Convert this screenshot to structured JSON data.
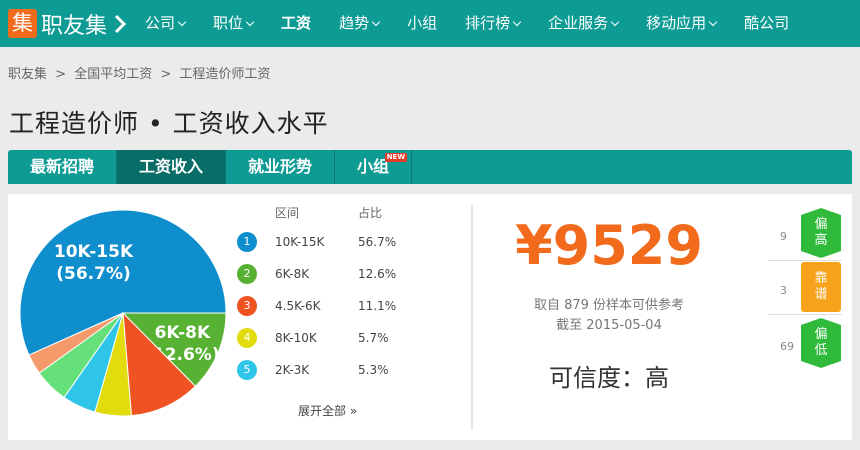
{
  "nav": {
    "logo_char": "集",
    "logo_text": "职友集",
    "items": [
      {
        "label": "公司",
        "dropdown": true
      },
      {
        "label": "职位",
        "dropdown": true
      },
      {
        "label": "工资",
        "dropdown": false,
        "active": true
      },
      {
        "label": "趋势",
        "dropdown": true
      },
      {
        "label": "小组",
        "dropdown": false
      },
      {
        "label": "排行榜",
        "dropdown": true
      },
      {
        "label": "企业服务",
        "dropdown": true
      },
      {
        "label": "移动应用",
        "dropdown": true
      },
      {
        "label": "酷公司",
        "dropdown": false
      }
    ]
  },
  "breadcrumb": [
    "职友集",
    ">",
    "全国平均工资",
    ">",
    "工程造价师工资"
  ],
  "page_title": "工程造价师 • 工资收入水平",
  "tabs": [
    {
      "label": "最新招聘"
    },
    {
      "label": "工资收入",
      "active": true
    },
    {
      "label": "就业形势"
    },
    {
      "label": "小组",
      "badge": "NEW"
    }
  ],
  "legend": {
    "col_range": "区间",
    "col_pct": "占比",
    "expand": "展开全部 »"
  },
  "chart_data": {
    "type": "pie",
    "slices": [
      {
        "rank": "1",
        "label": "10K-15K",
        "value": 56.7,
        "pct_text": "56.7%",
        "color": "#0f8ecd",
        "pie_label": "10K-15K",
        "pie_pct": "(56.7%)"
      },
      {
        "rank": "2",
        "label": "6K-8K",
        "value": 12.6,
        "pct_text": "12.6%",
        "color": "#57b234",
        "pie_label": "6K-8K",
        "pie_pct": "(12.6%)"
      },
      {
        "rank": "3",
        "label": "4.5K-6K",
        "value": 11.1,
        "pct_text": "11.1%",
        "color": "#ef5322"
      },
      {
        "rank": "4",
        "label": "8K-10K",
        "value": 5.7,
        "pct_text": "5.7%",
        "color": "#e2db0d"
      },
      {
        "rank": "5",
        "label": "2K-3K",
        "value": 5.3,
        "pct_text": "5.3%",
        "color": "#2ec5e8"
      },
      {
        "label": "other",
        "value": 5.4,
        "color": "#66e07a"
      },
      {
        "label": "other",
        "value": 3.2,
        "color": "#f59b6b"
      }
    ]
  },
  "summary": {
    "price": "¥9529",
    "sample_line": "取自 879 份样本可供参考",
    "date_line": "截至 2015-05-04",
    "credibility": "可信度：高"
  },
  "side": [
    {
      "count": "9",
      "label": "偏\n高",
      "style": "green"
    },
    {
      "count": "3",
      "label": "靠\n谱",
      "style": "orange"
    },
    {
      "count": "69",
      "label": "偏\n低",
      "style": "green"
    }
  ]
}
